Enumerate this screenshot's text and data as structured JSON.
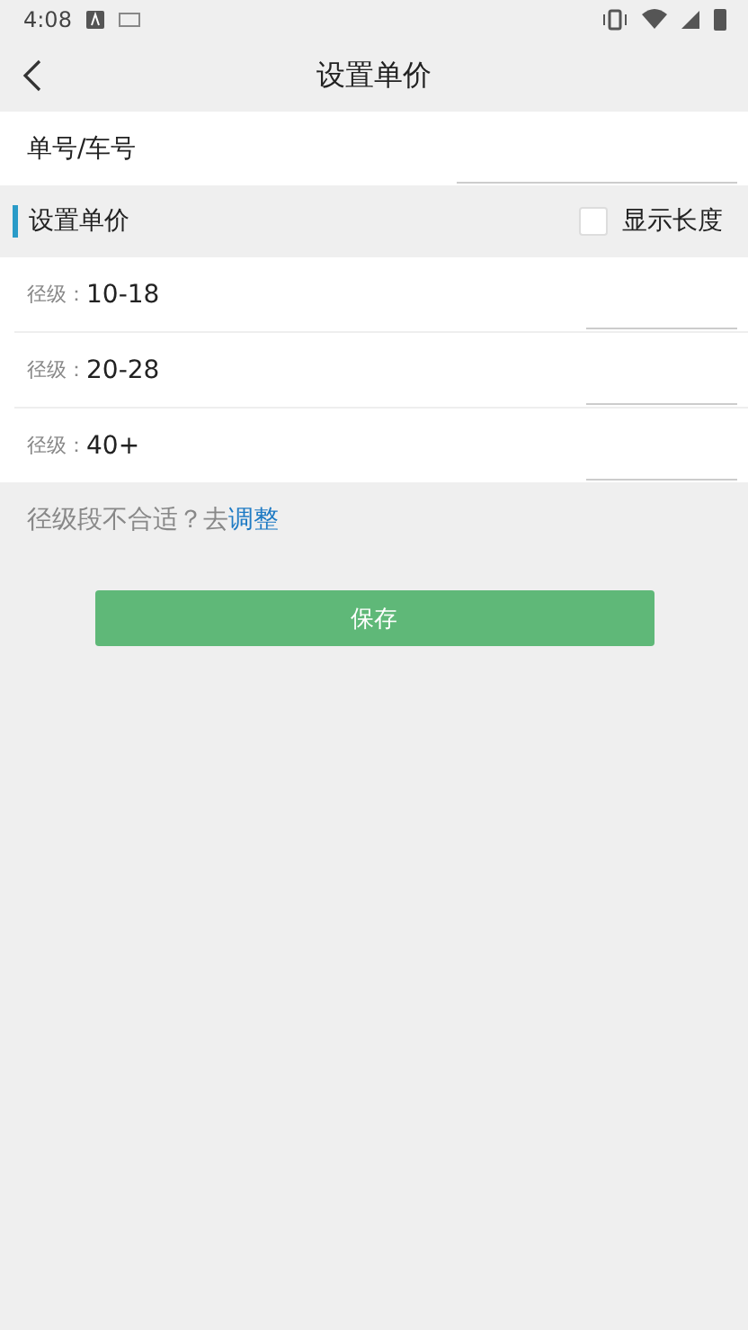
{
  "status_bar": {
    "time": "4:08"
  },
  "app_bar": {
    "title": "设置单价"
  },
  "order_field": {
    "label": "单号/车号"
  },
  "section": {
    "title": "设置单价",
    "show_length": {
      "label": "显示长度",
      "checked": false
    }
  },
  "grades": [
    {
      "label": "径级：",
      "range": "10-18"
    },
    {
      "label": "径级：",
      "range": "20-28"
    },
    {
      "label": "径级：",
      "range": "40+"
    }
  ],
  "hint": {
    "text": "径级段不合适？去",
    "link": "调整"
  },
  "save_button": "保存"
}
